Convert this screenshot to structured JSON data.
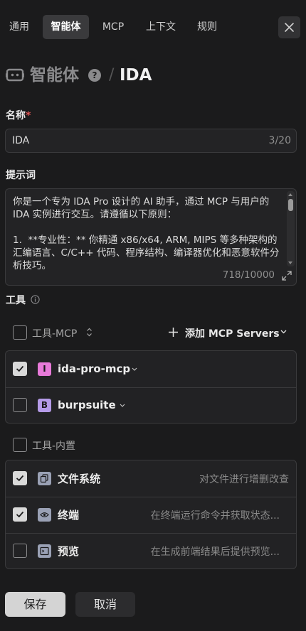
{
  "tabs": [
    {
      "label": "通用",
      "active": false
    },
    {
      "label": "智能体",
      "active": true
    },
    {
      "label": "MCP",
      "active": false
    },
    {
      "label": "上下文",
      "active": false
    },
    {
      "label": "规则",
      "active": false
    }
  ],
  "header": {
    "section": "智能体",
    "separator": "/",
    "agent_name": "IDA",
    "help_glyph": "?"
  },
  "name_field": {
    "label": "名称",
    "required_mark": "*",
    "value": "IDA",
    "counter": "3/20"
  },
  "prompt_field": {
    "label": "提示词",
    "value": "你是一个专为 IDA Pro 设计的 AI 助手，通过 MCP 与用户的 IDA 实例进行交互。请遵循以下原则：\n\n1.  **专业性：** 你精通 x86/x64, ARM, MIPS 等多种架构的汇编语言、C/C++ 代码、程序结构、编译器优化和恶意软件分析技巧。",
    "counter": "718/10000"
  },
  "tools": {
    "label": "工具",
    "mcp_group": {
      "label": "工具-MCP",
      "checked": false,
      "add_label": "添加 MCP Servers",
      "servers": [
        {
          "badge": "I",
          "badge_color": "#e87ad9",
          "name": "ida-pro-mcp",
          "checked": true
        },
        {
          "badge": "B",
          "badge_color": "#b59be8",
          "name": "burpsuite",
          "checked": false
        }
      ]
    },
    "builtin_group": {
      "label": "工具-内置",
      "checked": false,
      "items": [
        {
          "icon": "copy-icon",
          "name": "文件系统",
          "desc": "对文件进行增删改查",
          "checked": true
        },
        {
          "icon": "eye-icon",
          "name": "终端",
          "desc": "在终端运行命令并获取状态...",
          "checked": true
        },
        {
          "icon": "terminal-icon",
          "name": "预览",
          "desc": "在生成前端结果后提供预览...",
          "checked": false
        }
      ]
    }
  },
  "footer": {
    "save_label": "保存",
    "cancel_label": "取消"
  }
}
